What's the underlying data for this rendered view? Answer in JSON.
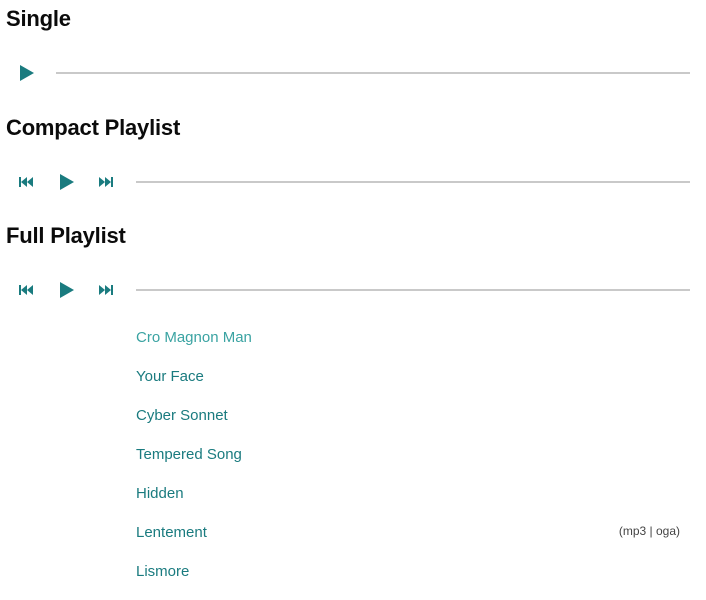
{
  "sections": {
    "single": {
      "title": "Single"
    },
    "compact": {
      "title": "Compact Playlist"
    },
    "full": {
      "title": "Full Playlist"
    }
  },
  "controls": {
    "icons": [
      "previous-track-icon",
      "play-icon",
      "next-track-icon"
    ],
    "accent_color": "#1a7b7f",
    "track_color": "#c9c9c9"
  },
  "playlist": {
    "items": [
      {
        "title": "Cro Magnon Man",
        "state": "current"
      },
      {
        "title": "Your Face"
      },
      {
        "title": "Cyber Sonnet"
      },
      {
        "title": "Tempered Song"
      },
      {
        "title": "Hidden"
      },
      {
        "title": "Lentement",
        "formats": {
          "open": "(",
          "mp3": "mp3",
          "separator": " | ",
          "oga": "oga",
          "close": ")"
        }
      },
      {
        "title": "Lismore"
      }
    ]
  }
}
